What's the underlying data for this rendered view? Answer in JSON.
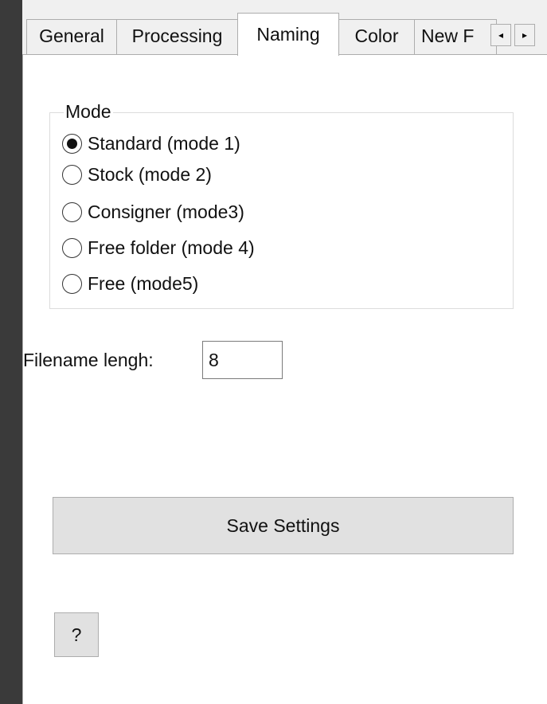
{
  "tabs": [
    {
      "label": "General",
      "active": false
    },
    {
      "label": "Processing",
      "active": false
    },
    {
      "label": "Naming",
      "active": true
    },
    {
      "label": "Color",
      "active": false
    },
    {
      "label": "New F",
      "active": false
    }
  ],
  "tab_scroll": {
    "left_icon": "triangle-left-icon",
    "right_icon": "triangle-right-icon",
    "left_glyph": "◂",
    "right_glyph": "▸"
  },
  "mode_group": {
    "legend": "Mode",
    "options": [
      {
        "label": "Standard (mode 1)",
        "selected": true
      },
      {
        "label": "Stock (mode 2)",
        "selected": false
      },
      {
        "label": "Consigner (mode3)",
        "selected": false
      },
      {
        "label": "Free folder (mode 4)",
        "selected": false
      },
      {
        "label": "Free (mode5)",
        "selected": false
      }
    ]
  },
  "filename_length": {
    "label": "Filename lengh:",
    "value": "8"
  },
  "save_button": {
    "label": "Save Settings"
  },
  "help_button": {
    "label": "?"
  },
  "colors": {
    "window_frame": "#3a3a3a",
    "panel": "#ffffff",
    "button_face": "#e1e1e1",
    "tab_face": "#f0f0f0"
  }
}
